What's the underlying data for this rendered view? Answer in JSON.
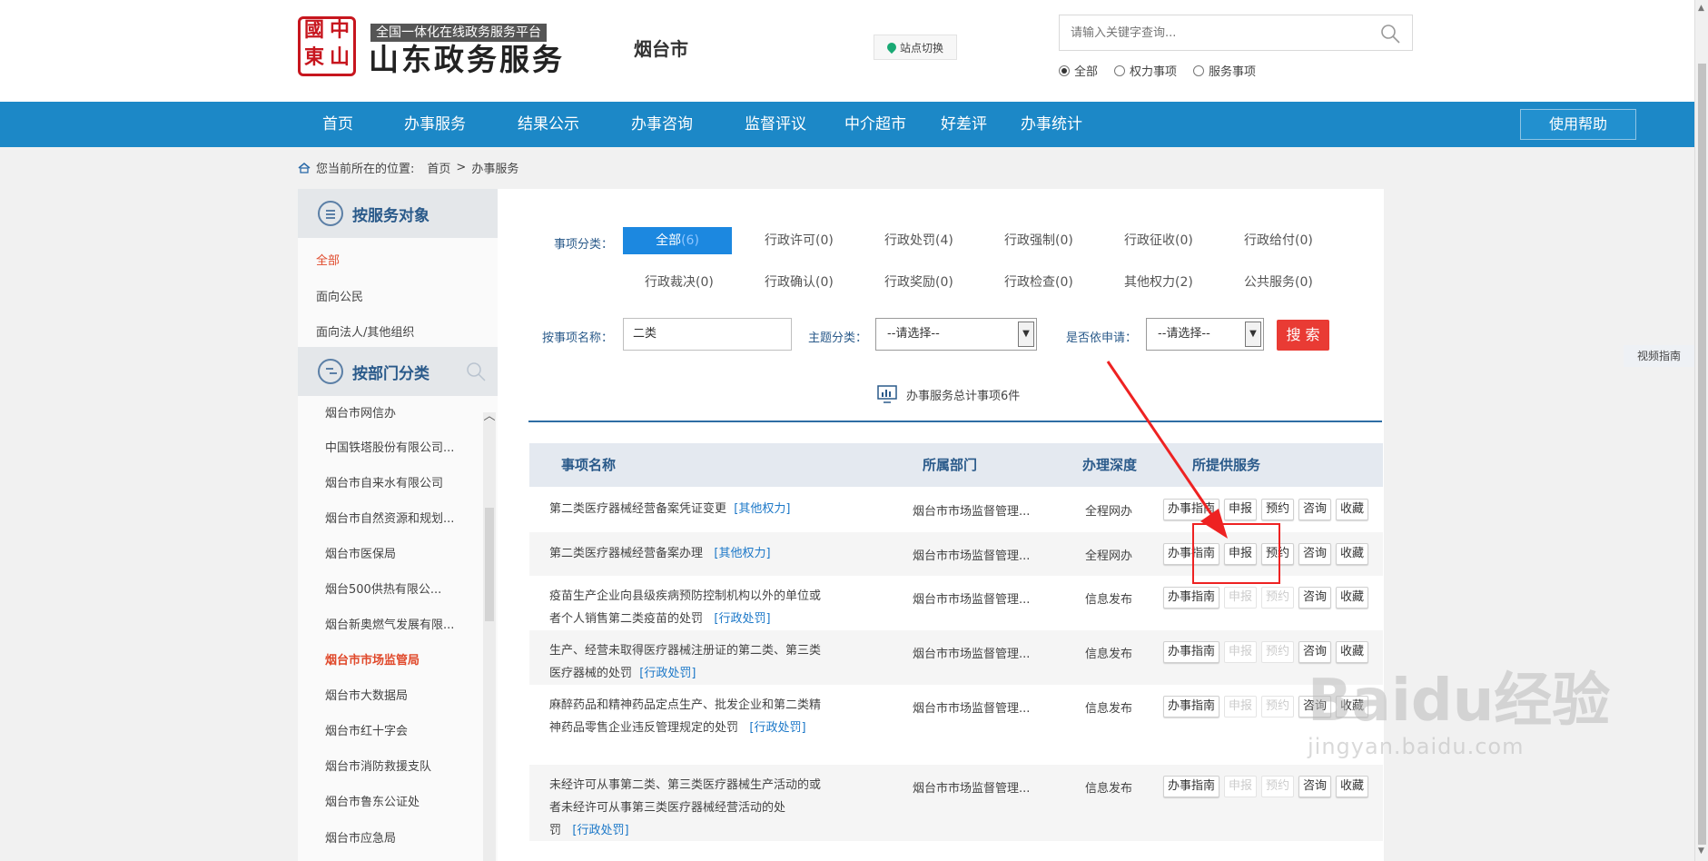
{
  "header": {
    "platform_tag": "全国一体化在线政务服务平台",
    "title": "山东政务服务",
    "logo_glyphs": [
      "中",
      "國",
      "山",
      "東"
    ],
    "city": "烟台市",
    "site_switch": "站点切换",
    "search": {
      "placeholder": "请输入关键字查询...",
      "scopes": [
        {
          "label": "全部",
          "checked": true
        },
        {
          "label": "权力事项",
          "checked": false
        },
        {
          "label": "服务事项",
          "checked": false
        }
      ]
    }
  },
  "nav": {
    "items": [
      "首页",
      "办事服务",
      "结果公示",
      "办事咨询",
      "监督评议",
      "中介超市",
      "好差评",
      "办事统计"
    ],
    "help": "使用帮助"
  },
  "breadcrumb": {
    "prefix": "您当前所在的位置:",
    "items": [
      "首页",
      ">",
      "办事服务"
    ]
  },
  "sidebar": {
    "by_target": {
      "title": "按服务对象",
      "items": [
        "全部",
        "面向公民",
        "面向法人/其他组织"
      ],
      "active_index": 0
    },
    "by_dept": {
      "title": "按部门分类",
      "items": [
        "烟台市网信办",
        "中国铁塔股份有限公司...",
        "烟台市自来水有限公司",
        "烟台市自然资源和规划...",
        "烟台市医保局",
        "烟台500供热有限公...",
        "烟台新奥燃气发展有限...",
        "烟台市市场监管局",
        "烟台市大数据局",
        "烟台市红十字会",
        "烟台市消防救援支队",
        "烟台市鲁东公证处",
        "烟台市应急局"
      ],
      "active_index": 7
    }
  },
  "filters": {
    "category_label": "事项分类：",
    "categories": [
      {
        "label": "全部",
        "count": "(6)"
      },
      {
        "label": "行政许可",
        "count": "(0)"
      },
      {
        "label": "行政处罚",
        "count": "(4)"
      },
      {
        "label": "行政强制",
        "count": "(0)"
      },
      {
        "label": "行政征收",
        "count": "(0)"
      },
      {
        "label": "行政给付",
        "count": "(0)"
      },
      {
        "label": "行政裁决",
        "count": "(0)"
      },
      {
        "label": "行政确认",
        "count": "(0)"
      },
      {
        "label": "行政奖励",
        "count": "(0)"
      },
      {
        "label": "行政检查",
        "count": "(0)"
      },
      {
        "label": "其他权力",
        "count": "(2)"
      },
      {
        "label": "公共服务",
        "count": "(0)"
      }
    ],
    "name_label": "按事项名称：",
    "name_value": "二类",
    "theme_label": "主题分类：",
    "theme_value": "--请选择--",
    "apply_label": "是否依申请：",
    "apply_value": "--请选择--",
    "search_button": "搜 索"
  },
  "summary": {
    "text": "办事服务总计事项6件"
  },
  "table": {
    "headers": [
      "事项名称",
      "所属部门",
      "办理深度",
      "所提供服务"
    ],
    "rows": [
      {
        "name": "第二类医疗器械经营备案凭证变更",
        "tag": "[其他权力]",
        "dept": "烟台市市场监督管理...",
        "depth": "全程网办",
        "services": [
          {
            "label": "办事指南",
            "enabled": true
          },
          {
            "label": "申报",
            "enabled": true
          },
          {
            "label": "预约",
            "enabled": true
          },
          {
            "label": "咨询",
            "enabled": true
          },
          {
            "label": "收藏",
            "enabled": true
          }
        ]
      },
      {
        "name": "第二类医疗器械经营备案办理",
        "tag": "[其他权力]",
        "dept": "烟台市市场监督管理...",
        "depth": "全程网办",
        "services": [
          {
            "label": "办事指南",
            "enabled": true
          },
          {
            "label": "申报",
            "enabled": true
          },
          {
            "label": "预约",
            "enabled": true
          },
          {
            "label": "咨询",
            "enabled": true
          },
          {
            "label": "收藏",
            "enabled": true
          }
        ]
      },
      {
        "name": "疫苗生产企业向县级疾病预防控制机构以外的单位或者个人销售第二类疫苗的处罚",
        "tag": "[行政处罚]",
        "dept": "烟台市市场监督管理...",
        "depth": "信息发布",
        "services": [
          {
            "label": "办事指南",
            "enabled": true
          },
          {
            "label": "申报",
            "enabled": false
          },
          {
            "label": "预约",
            "enabled": false
          },
          {
            "label": "咨询",
            "enabled": true
          },
          {
            "label": "收藏",
            "enabled": true
          }
        ]
      },
      {
        "name": "生产、经营未取得医疗器械注册证的第二类、第三类医疗器械的处罚",
        "tag": "[行政处罚]",
        "dept": "烟台市市场监督管理...",
        "depth": "信息发布",
        "services": [
          {
            "label": "办事指南",
            "enabled": true
          },
          {
            "label": "申报",
            "enabled": false
          },
          {
            "label": "预约",
            "enabled": false
          },
          {
            "label": "咨询",
            "enabled": true
          },
          {
            "label": "收藏",
            "enabled": true
          }
        ]
      },
      {
        "name": "麻醉药品和精神药品定点生产、批发企业和第二类精神药品零售企业违反管理规定的处罚",
        "tag": "[行政处罚]",
        "dept": "烟台市市场监督管理...",
        "depth": "信息发布",
        "services": [
          {
            "label": "办事指南",
            "enabled": true
          },
          {
            "label": "申报",
            "enabled": false
          },
          {
            "label": "预约",
            "enabled": false
          },
          {
            "label": "咨询",
            "enabled": true
          },
          {
            "label": "收藏",
            "enabled": true
          }
        ]
      },
      {
        "name": "未经许可从事第二类、第三类医疗器械生产活动的或者未经许可从事第三类医疗器械经营活动的处罚",
        "tag": "[行政处罚]",
        "dept": "烟台市市场监督管理...",
        "depth": "信息发布",
        "services": [
          {
            "label": "办事指南",
            "enabled": true
          },
          {
            "label": "申报",
            "enabled": false
          },
          {
            "label": "预约",
            "enabled": false
          },
          {
            "label": "咨询",
            "enabled": true
          },
          {
            "label": "收藏",
            "enabled": true
          }
        ]
      }
    ]
  },
  "side_float": "视频指南",
  "watermark": {
    "brand": "Baidu经验",
    "url": "jingyan.baidu.com"
  },
  "colors": {
    "nav": "#1c88c7",
    "accent_red": "#e93b34",
    "active_orange": "#e0492b",
    "link_blue": "#1c78c8"
  }
}
